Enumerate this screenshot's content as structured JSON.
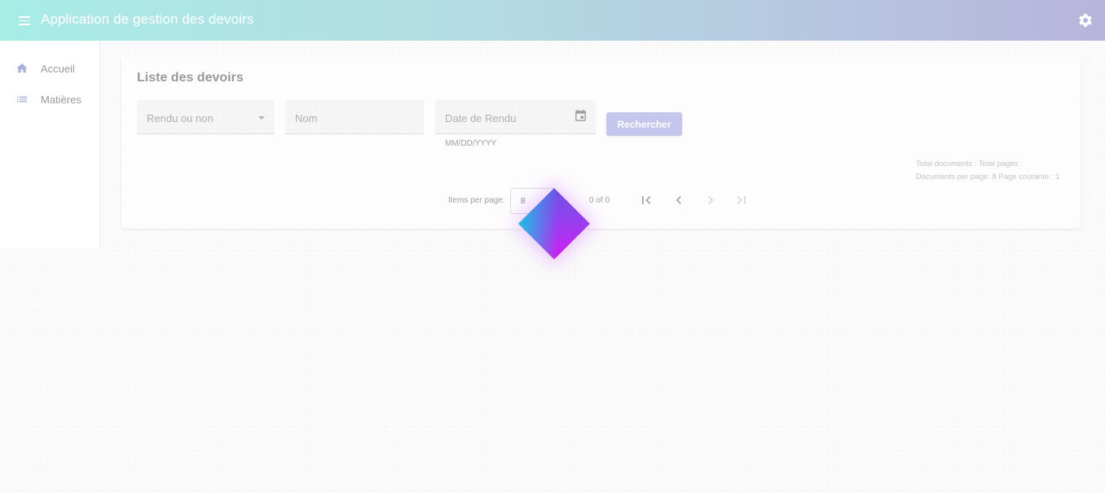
{
  "toolbar": {
    "title": "Application de gestion des devoirs",
    "menu_icon": "menu-icon",
    "settings_icon": "gear-icon",
    "gradient": [
      "#a8ece6",
      "#b8b4da"
    ]
  },
  "sidebar": {
    "items": [
      {
        "label": "Accueil",
        "icon": "home-icon"
      },
      {
        "label": "Matières",
        "icon": "list-icon"
      }
    ]
  },
  "main": {
    "title": "Liste des devoirs",
    "filters": {
      "rendu_placeholder": "Rendu ou non",
      "nom_placeholder": "Nom",
      "date_placeholder": "Date de Rendu",
      "date_hint": "MM/DD/YYYY"
    },
    "search_button": "Rechercher",
    "search_button_color": "#c4c6ec",
    "stats": {
      "line1": "Total documents :  Total pages :",
      "line2": "Documents per page: 8 Page courante : 1"
    },
    "paginator": {
      "items_per_page_label": "Items per page:",
      "page_size": "8",
      "range": "0 of 0",
      "buttons": [
        "first-page-icon",
        "previous-page-icon",
        "next-page-icon",
        "last-page-icon"
      ]
    }
  },
  "loader": {
    "colors": [
      "#19c3e6",
      "#9a3ef0",
      "#d21cf0"
    ]
  }
}
